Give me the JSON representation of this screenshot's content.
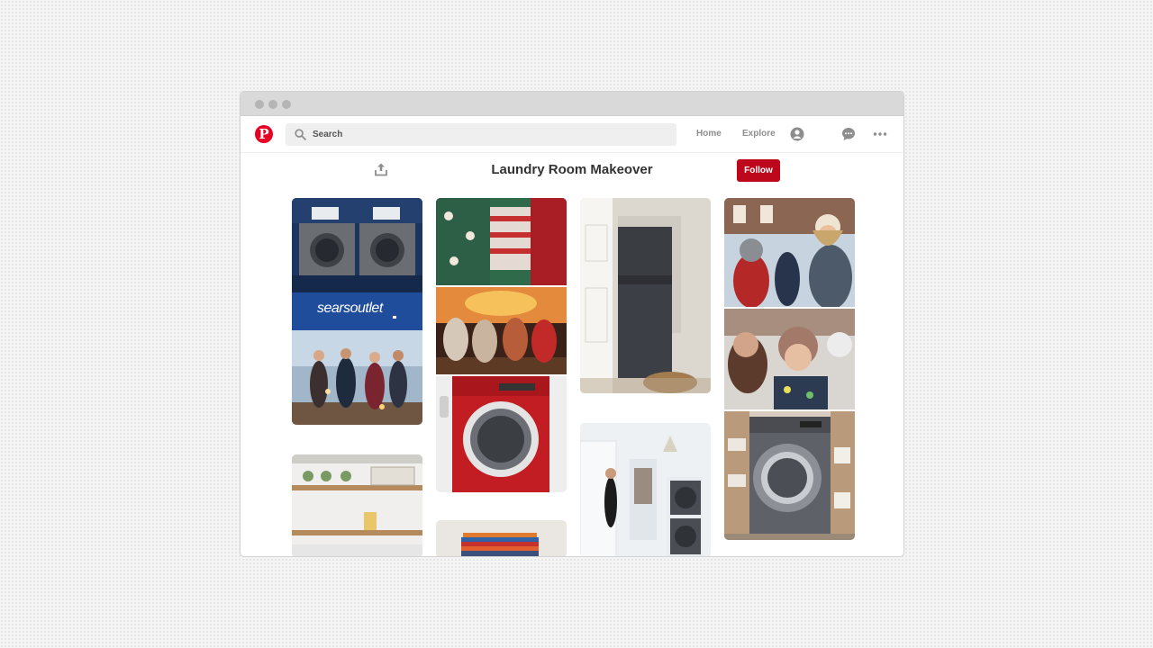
{
  "window": {
    "controls": [
      "close",
      "minimize",
      "maximize"
    ]
  },
  "navbar": {
    "logo_letter": "P",
    "search": {
      "placeholder": "Search",
      "value": ""
    },
    "links": {
      "home": "Home",
      "explore": "Explore"
    },
    "icons": [
      "search-icon",
      "profile-icon",
      "messages-icon",
      "more-icon"
    ]
  },
  "board": {
    "title": "Laundry Room Makeover",
    "follow_label": "Follow"
  },
  "pins": {
    "searsoutlet_logo": "searsoutlet"
  },
  "colors": {
    "brand_red": "#e60023",
    "follow_red": "#bd081c",
    "washer_red": "#c31d24",
    "banner_blue": "#1f4d9c"
  }
}
